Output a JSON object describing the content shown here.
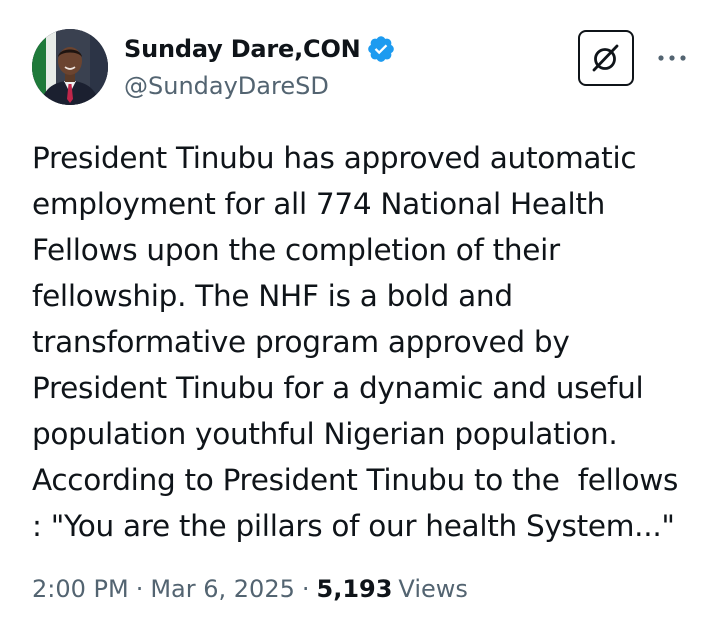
{
  "author": {
    "display_name": "Sunday Dare,CON",
    "handle": "@SundayDareSD",
    "verified": true,
    "avatar_icon": "profile-photo"
  },
  "actions": {
    "grok_icon": "grok-icon",
    "more_icon": "more-horizontal-icon"
  },
  "tweet": {
    "text": "President Tinubu has approved automatic\nemployment for all 774 National Health\nFellows upon the completion of their\nfellowship. The NHF is a bold and\ntransformative program approved by\nPresident Tinubu for a dynamic and useful\npopulation youthful Nigerian population.\nAccording to President Tinubu to the  fellows\n: \"You are the pillars of our health System...\""
  },
  "meta": {
    "time": "2:00 PM",
    "separator": "·",
    "date": "Mar 6, 2025",
    "views_count": "5,193",
    "views_label": "Views"
  },
  "colors": {
    "verified_badge": "#1d9bf0",
    "secondary_text": "#536471",
    "primary_text": "#0f1419"
  }
}
